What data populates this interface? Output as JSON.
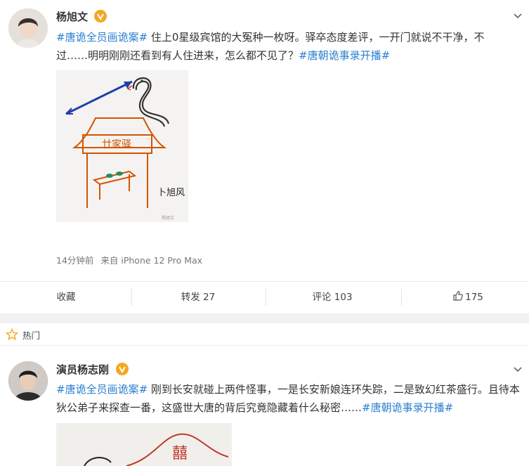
{
  "post1": {
    "author": "杨旭文",
    "text_tag1": "#唐诡全员画诡案#",
    "text_body": " 住上0星级宾馆的大冤种一枚呀。驿卒态度差评，一开门就说不干净，不过……明明刚刚还看到有人住进来，怎么都不见了？",
    "text_tag2": "#唐朝诡事录开播#",
    "image_sign": "卜旭风",
    "image_sign_small": "杨旭文",
    "image_plaque": "廿家驿",
    "time": "14分钟前",
    "source": "来自 iPhone 12 Pro Max",
    "actions": {
      "collect": "收藏",
      "repost": "转发 27",
      "comment": "评论 103",
      "like": "175"
    }
  },
  "hot": {
    "label": "热门"
  },
  "post2": {
    "author": "演员杨志刚",
    "text_tag1": "#唐诡全员画诡案#",
    "text_body": " 刚到长安就碰上两件怪事，一是长安新娘连环失踪，二是致幻红茶盛行。且待本狄公弟子来探查一番，这盛世大唐的背后究竟隐藏着什么秘密……",
    "text_tag2": "#唐朝诡事录开播#",
    "image_char": "囍"
  },
  "colors": {
    "link": "#2a7fcf",
    "badge": "#f5a623",
    "bg": "#f2f2f5"
  }
}
